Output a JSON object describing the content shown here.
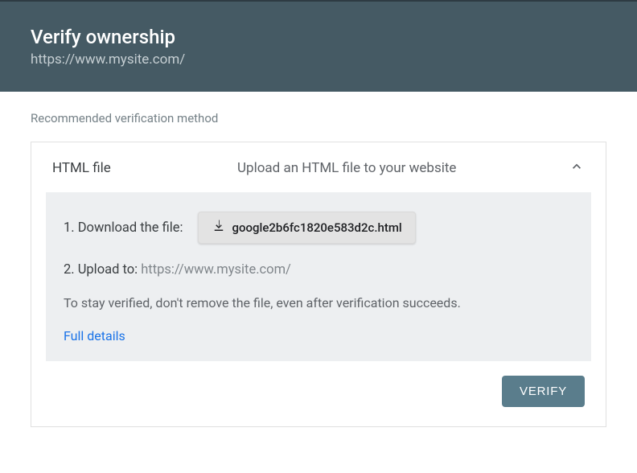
{
  "header": {
    "title": "Verify ownership",
    "url": "https://www.mysite.com/"
  },
  "section": {
    "label": "Recommended verification method"
  },
  "method": {
    "name": "HTML file",
    "description": "Upload an HTML file to your website"
  },
  "steps": {
    "step1_label": "1. Download the file:",
    "download_filename": "google2b6fc1820e583d2c.html",
    "step2_label": "2. Upload to: ",
    "step2_url": "https://www.mysite.com/",
    "note": "To stay verified, don't remove the file, even after verification succeeds.",
    "details_link": "Full details"
  },
  "actions": {
    "verify_label": "VERIFY"
  }
}
